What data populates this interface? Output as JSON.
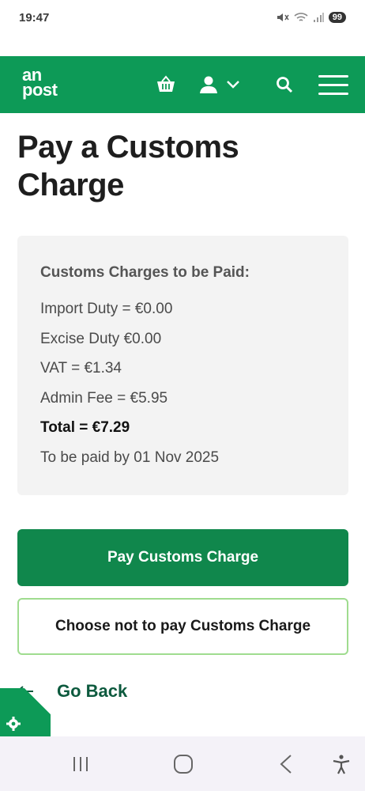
{
  "status_bar": {
    "time": "19:47",
    "battery": "99"
  },
  "header": {
    "logo_line1": "an",
    "logo_line2": "post",
    "icons": [
      "basket-icon",
      "account-icon",
      "chevron-down-icon",
      "search-icon",
      "menu-icon"
    ]
  },
  "page": {
    "title": "Pay a Customs Charge"
  },
  "charges": {
    "heading": "Customs Charges to be Paid:",
    "import_duty": "Import Duty = €0.00",
    "excise_duty": "Excise Duty €0.00",
    "vat": "VAT = €1.34",
    "admin_fee": "Admin Fee = €5.95",
    "total": "Total = €7.29",
    "due_date": "To be paid by 01 Nov 2025"
  },
  "actions": {
    "pay_label": "Pay Customs Charge",
    "decline_label": "Choose not to pay Customs Charge",
    "back_label": "Go Back"
  },
  "colors": {
    "brand_green": "#0d9a57",
    "button_green": "#10874c",
    "secondary_border": "#9fdc8f",
    "back_link": "#0d5a3e"
  }
}
